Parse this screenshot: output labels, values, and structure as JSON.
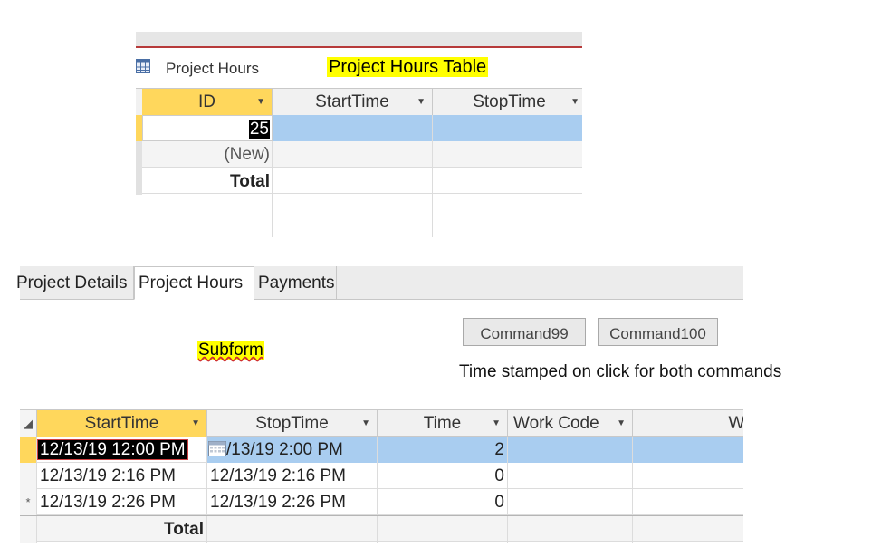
{
  "top_table": {
    "tab_title": "Project Hours",
    "annotation": "Project Hours Table",
    "columns": [
      "ID",
      "StartTime",
      "StopTime"
    ],
    "rows": [
      {
        "id": "25",
        "start": "",
        "stop": ""
      },
      {
        "id": "(New)",
        "start": "",
        "stop": ""
      }
    ],
    "total_label": "Total"
  },
  "form_tabs": [
    "Project Details",
    "Project Hours",
    "Payments"
  ],
  "commands": [
    "Command99",
    "Command100"
  ],
  "subform_label": "Subform",
  "note": "Time stamped on click for both commands",
  "subgrid": {
    "columns": [
      "StartTime",
      "StopTime",
      "Time",
      "Work Code",
      "Wor"
    ],
    "rows": [
      {
        "start": "12/13/19 12:00 PM",
        "stop": "/13/19 2:00 PM",
        "time": "2"
      },
      {
        "start": "12/13/19 2:16 PM",
        "stop": "12/13/19 2:16 PM",
        "time": "0"
      },
      {
        "start": "12/13/19 2:26 PM",
        "stop": "12/13/19 2:26 PM",
        "time": "0"
      }
    ],
    "new_row_marker": "*",
    "total_label": "Total"
  },
  "colors": {
    "selected_header": "#ffd75c",
    "selected_row": "#a9cdf0",
    "highlight": "#ffff00"
  }
}
